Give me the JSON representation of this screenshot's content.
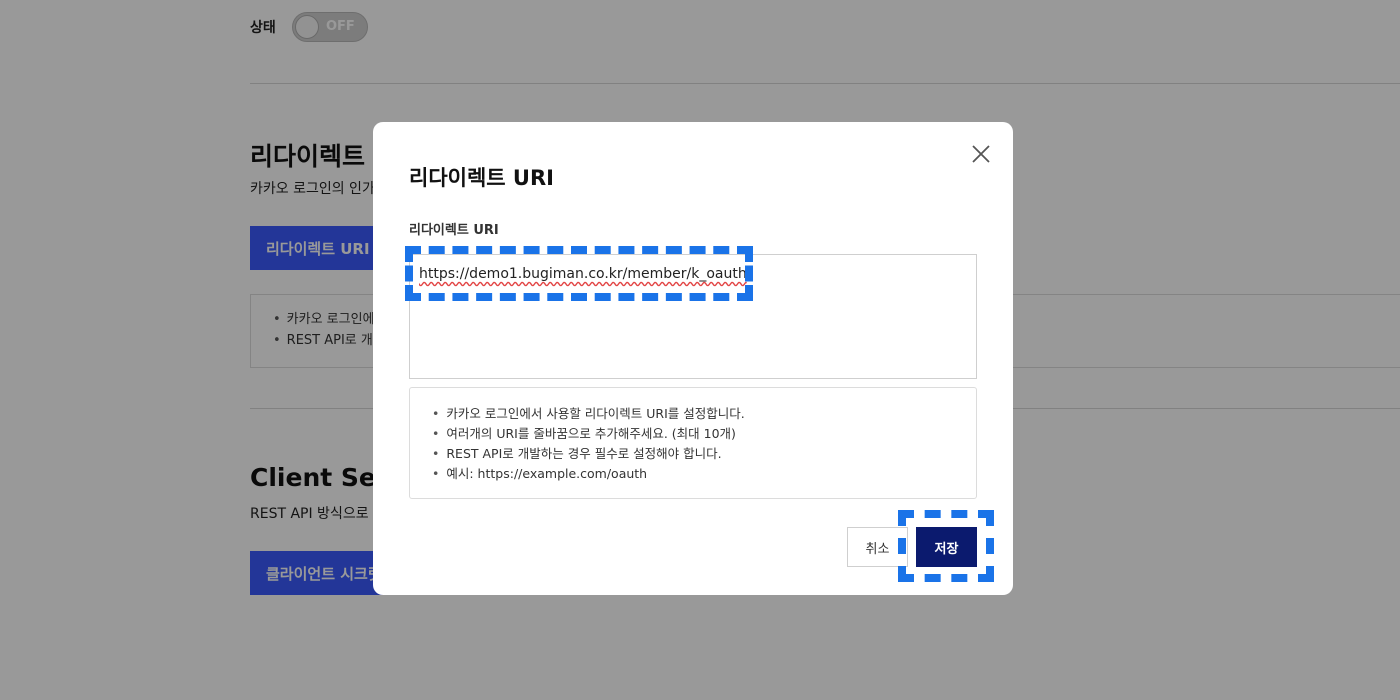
{
  "background": {
    "status_label": "상태",
    "status_toggle": "OFF",
    "redirect_section": {
      "title": "리다이렉트 URI",
      "description": "카카오 로그인의 인가 코드를 받을 리다이렉트 URI를 설정합니다.",
      "button_label": "리다이렉트 URI 등록",
      "notes": [
        "카카오 로그인에서 사용할 리다이렉트 URI를 설정합니다.",
        "REST API로 개발하는 경우 필수로 설정해야 합니다."
      ]
    },
    "client_secret_section": {
      "title": "Client Secret",
      "description": "REST API 방식으로 토큰을 발급받을 때 보안을 강화하기 위해 사용합니다.",
      "button_label": "클라이언트 시크릿 코드 생성"
    }
  },
  "modal": {
    "title": "리다이렉트 URI",
    "field_label": "리다이렉트 URI",
    "uri_value": "https://demo1.bugiman.co.kr/member/k_oauth",
    "hints": [
      "카카오 로그인에서 사용할 리다이렉트 URI를 설정합니다.",
      "여러개의 URI를 줄바꿈으로 추가해주세요. (최대 10개)",
      "REST API로 개발하는 경우 필수로 설정해야 합니다.",
      "예시: https://example.com/oauth"
    ],
    "cancel_label": "취소",
    "save_label": "저장"
  },
  "icons": {
    "close": "close-icon"
  },
  "colors": {
    "primary": "#3b5bfd",
    "save": "#0b1a6e",
    "highlight": "#1a73e8"
  }
}
